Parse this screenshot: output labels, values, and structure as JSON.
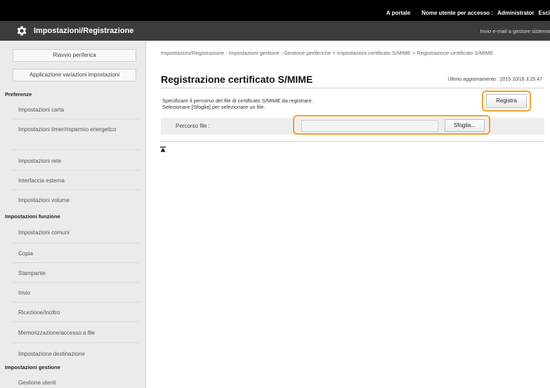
{
  "topbar": {
    "portal": "A portale",
    "login_label": "Nome utente per accesso :",
    "login_user": "Administrator",
    "logout": "Esci"
  },
  "header": {
    "title": "Impostazioni/Registrazione",
    "mail_link": "Invio e-mail a gestore sistema",
    "logo_icon": "gear-icon"
  },
  "sidebar": {
    "buttons": {
      "summary": "Riavvio periferica",
      "apply": "Applicazione variazioni impostazioni"
    },
    "sections": [
      {
        "title": "Preferenze",
        "items": [
          "Impostazioni carta",
          "Impostazioni timer/risparmio energetico",
          "Impostazioni rete",
          "Interfaccia esterna",
          "Impostazioni volume"
        ]
      },
      {
        "title": "Impostazioni funzione",
        "items": [
          "Impostazioni comuni",
          "Copia",
          "Stampante",
          "Invio",
          "Ricezione/Inoltro",
          "Memorizzazione/accesso a file"
        ]
      },
      {
        "title": "",
        "items": [
          "Impostazione destinazione"
        ]
      },
      {
        "title": "Impostazioni gestione",
        "items": [
          "Gestione utenti"
        ]
      }
    ]
  },
  "content": {
    "breadcrumb": "Impostazioni/Registrazione : Impostazioni gestione : Gestione periferiche > Impostazioni certificato S/MIME > Registrazione certificato S/MIME",
    "title": "Registrazione certificato S/MIME",
    "last_update": "Ultimo aggiornamento : 2015 10/16 3:25:47",
    "desc_line1": "Specificare il percorso del file di certificato S/MIME da registrare.",
    "desc_line2": "Selezionare [Sfoglia] per selezionare un file.",
    "register_button": "Registra",
    "file_label": "Percorso file :",
    "file_value": "",
    "browse_button": "Sfoglia...",
    "top_icon": "to-top-icon"
  },
  "colors": {
    "topbar": "#000000",
    "header": "#3c3c3c",
    "sidebar": "#ebebeb",
    "highlight": "#f0a22e"
  }
}
